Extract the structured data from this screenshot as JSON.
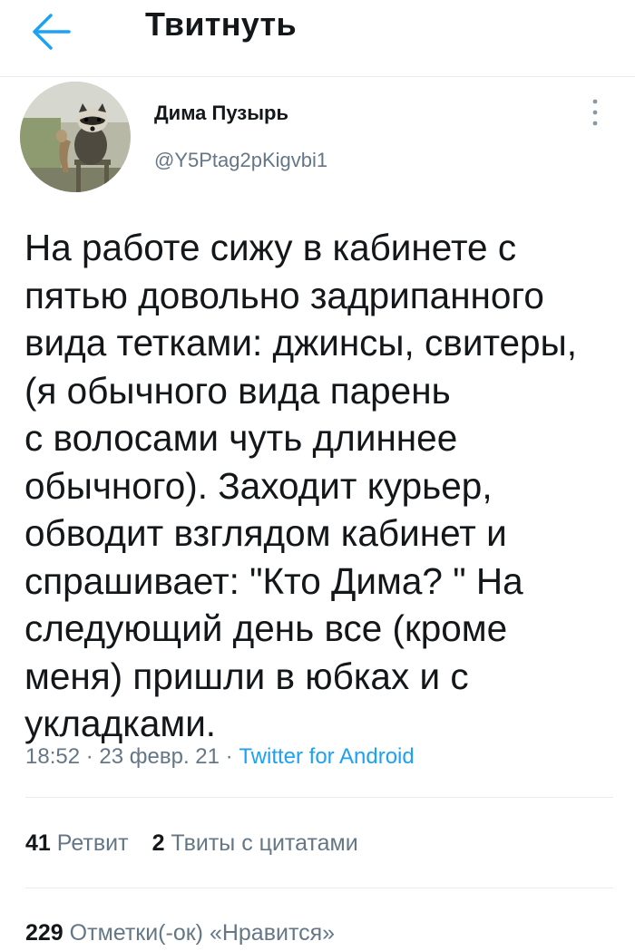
{
  "header": {
    "title": "Твитнуть"
  },
  "author": {
    "name": "Дима Пузырь",
    "handle": "@Y5Ptag2pKigvbi1"
  },
  "tweet": {
    "text": "На работе сижу в кабинете с\nпятью довольно задрипанного\nвида тетками: джинсы, свитеры,\n(я обычного вида парень\nс волосами чуть длиннее\nобычного). Заходит курьер,\nобводит взглядом кабинет и\nспрашивает: \"Кто  Дима? \" На\nследующий день все (кроме\nменя) пришли в юбках и с\nукладками.",
    "time": "18:52",
    "date": "23 февр. 21",
    "separator": " · ",
    "source": "Twitter for Android"
  },
  "stats": {
    "retweets_count": "41",
    "retweets_label": "Ретвит",
    "quotes_count": "2",
    "quotes_label": "Твиты с цитатами",
    "likes_count": "229",
    "likes_label": "Отметки(-ок) «Нравится»"
  },
  "colors": {
    "accent": "#1da1f2",
    "secondary_text": "#657786",
    "primary_text": "#14171a",
    "divider": "#e6ecf0"
  },
  "icons": {
    "back": "arrow-left-icon",
    "more": "vertical-dots-icon"
  }
}
